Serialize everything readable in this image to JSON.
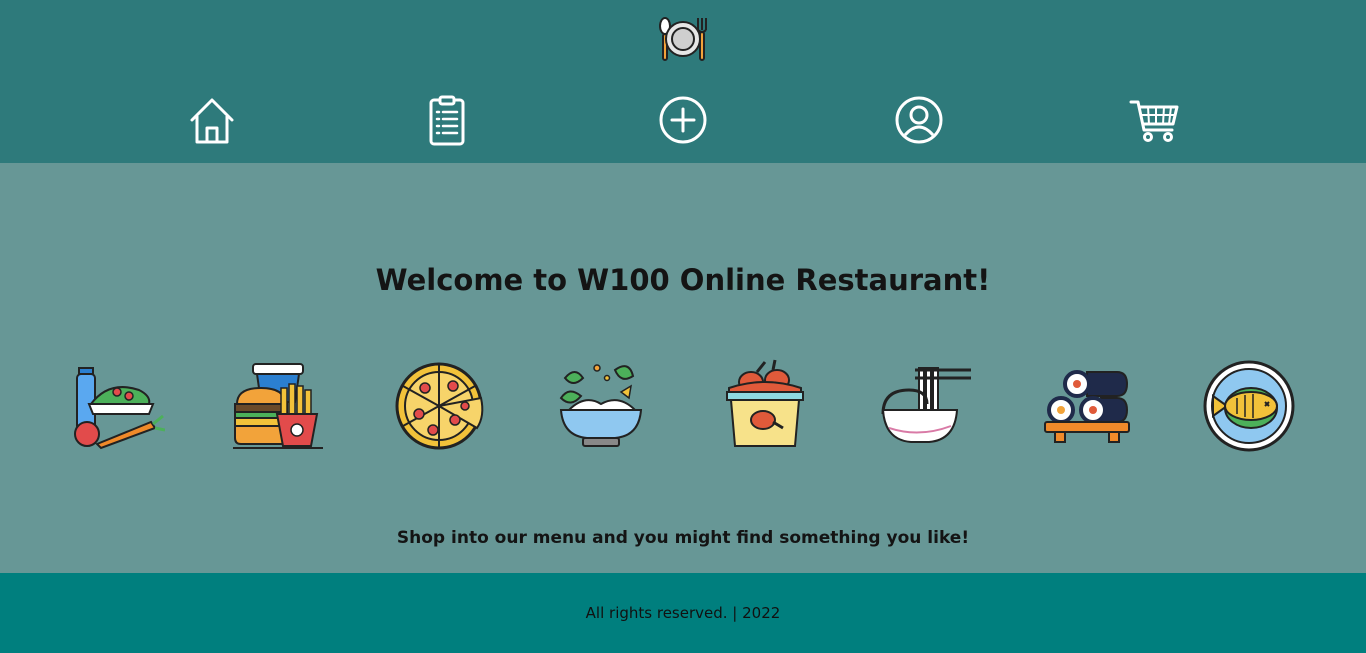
{
  "header": {
    "logo_icon": "plate-with-cutlery-icon",
    "nav": [
      {
        "name": "home",
        "icon": "home-icon"
      },
      {
        "name": "menu",
        "icon": "clipboard-list-icon"
      },
      {
        "name": "add",
        "icon": "plus-circle-icon"
      },
      {
        "name": "account",
        "icon": "user-circle-icon"
      },
      {
        "name": "cart",
        "icon": "shopping-cart-icon"
      }
    ]
  },
  "main": {
    "welcome": "Welcome to W100 Online Restaurant!",
    "food_icons": [
      "salad-vegetables-icon",
      "burger-fries-drink-icon",
      "pizza-icon",
      "rice-bowl-icon",
      "fried-chicken-bucket-icon",
      "noodles-bowl-icon",
      "sushi-rolls-icon",
      "fish-plate-icon"
    ],
    "tagline": "Shop into our menu and you might find something you like!"
  },
  "footer": {
    "text": "All rights reserved. | 2022"
  },
  "colors": {
    "header_bg": "#2e7a7b",
    "main_bg": "#679796",
    "footer_bg": "#007f7e"
  }
}
